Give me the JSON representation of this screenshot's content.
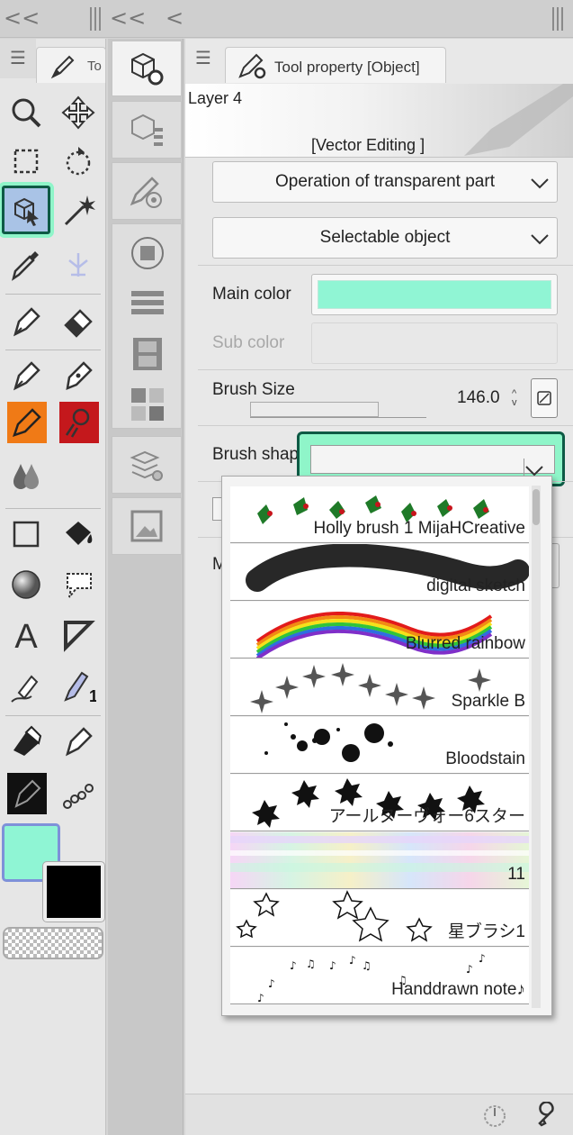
{
  "topbar": {
    "collapse_left": "<<",
    "collapse_mid": "<<",
    "back": "<"
  },
  "toolbox": {
    "tab_label": "To"
  },
  "tool_property": {
    "tab_label": "Tool property [Object]",
    "layer_name": "Layer 4",
    "editing_mode": "[Vector Editing ]",
    "operation_dropdown": "Operation of transparent part",
    "selectable_dropdown": "Selectable object",
    "main_color_label": "Main color",
    "main_color": "#90f5d4",
    "sub_color_label": "Sub color",
    "brush_size_label": "Brush Size",
    "brush_size_value": "146.0",
    "brush_size_fraction": 0.73,
    "brush_shape_label": "Brush shape",
    "hidden_row_label": "M"
  },
  "brush_shapes": [
    {
      "name": "Holly brush 1 MijaHCreative"
    },
    {
      "name": "digital sketch"
    },
    {
      "name": "Blurred rainbow"
    },
    {
      "name": "Sparkle B"
    },
    {
      "name": "Bloodstain"
    },
    {
      "name": "アールヌーヴォー6スター"
    },
    {
      "name": "11"
    },
    {
      "name": "星ブラシ1"
    },
    {
      "name": "Handdrawn note♪"
    }
  ],
  "colors": {
    "foreground": "#8ff5d4",
    "background": "#000000",
    "accent": "#8ff5c9",
    "selection_border": "#0e5a45"
  }
}
